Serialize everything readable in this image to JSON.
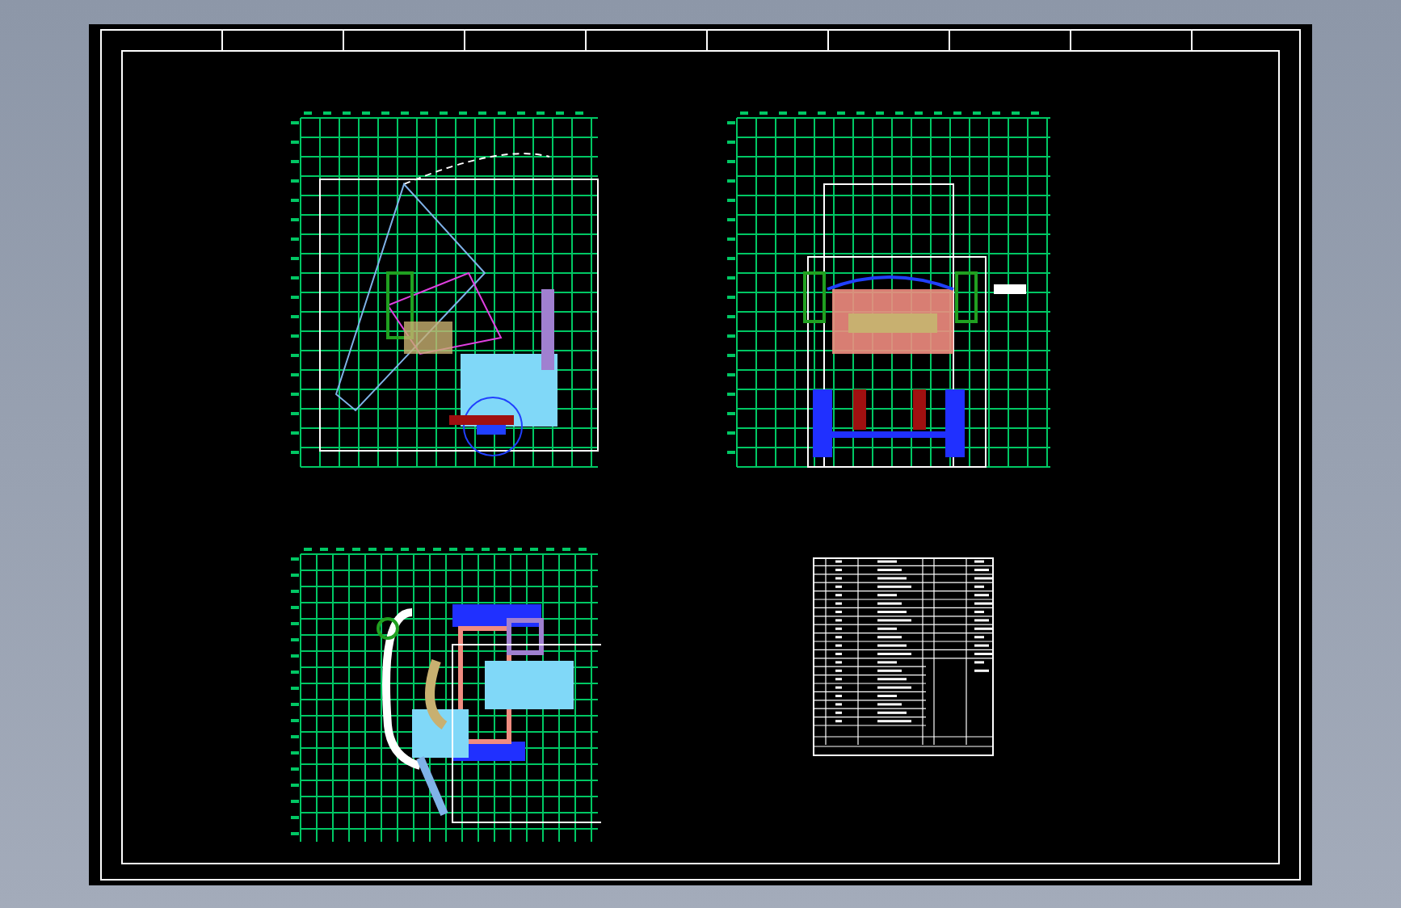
{
  "drawing_sheet": {
    "views": [
      {
        "kind": "side"
      },
      {
        "kind": "front"
      },
      {
        "kind": "top"
      }
    ],
    "parts_list": {
      "kind": "table"
    }
  }
}
